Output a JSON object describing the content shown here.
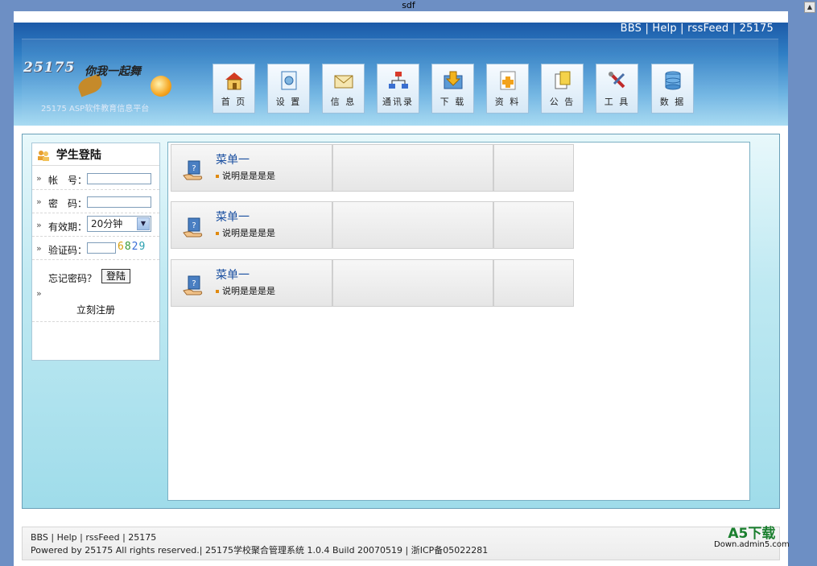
{
  "window": {
    "title": "sdf"
  },
  "header": {
    "top_links": [
      "BBS",
      "Help",
      "rssFeed",
      "25175"
    ],
    "logo_text": "25175",
    "logo_slogan": "你我一起舞",
    "logo_subtitle": "25175 ASP软件教育信息平台"
  },
  "nav": {
    "items": [
      {
        "label": "首 页",
        "icon": "home-icon"
      },
      {
        "label": "设 置",
        "icon": "settings-icon"
      },
      {
        "label": "信 息",
        "icon": "mail-icon"
      },
      {
        "label": "通讯录",
        "icon": "network-icon"
      },
      {
        "label": "下 载",
        "icon": "download-icon"
      },
      {
        "label": "资 料",
        "icon": "document-add-icon"
      },
      {
        "label": "公 告",
        "icon": "notice-icon"
      },
      {
        "label": "工 具",
        "icon": "tools-icon"
      },
      {
        "label": "数 据",
        "icon": "database-icon"
      }
    ]
  },
  "login": {
    "title": "学生登陆",
    "account_label": "帐　号：",
    "password_label": "密　码：",
    "validity_label": "有效期：",
    "validity_value": "20分钟",
    "captcha_label": "验证码：",
    "captcha_digits": [
      "6",
      "8",
      "2",
      "9"
    ],
    "captcha_colors": [
      "#d8a010",
      "#3a9a3a",
      "#3b6fd6",
      "#2aa0b0"
    ],
    "forgot_text": "忘记密码？",
    "login_button": "登陆",
    "register_text": "立刻注册",
    "marker": "»"
  },
  "menu": {
    "rows": [
      {
        "title": "菜单一",
        "desc": "说明是是是是"
      },
      {
        "title": "菜单一",
        "desc": "说明是是是是"
      },
      {
        "title": "菜单一",
        "desc": "说明是是是是"
      }
    ]
  },
  "footer": {
    "links_line": "BBS | Help | rssFeed | 25175",
    "powered_line": "Powered by 25175 All rights reserved.| 25175学校聚合管理系统  1.0.4 Build 20070519 | 浙ICP备05022281"
  },
  "watermark": {
    "line1": "A5下载",
    "line2": "Down.admin5.com"
  },
  "colors": {
    "header_blue": "#1c5aa8",
    "menu_title": "#1a4fa0",
    "page_bg": "#6d8fc4"
  }
}
